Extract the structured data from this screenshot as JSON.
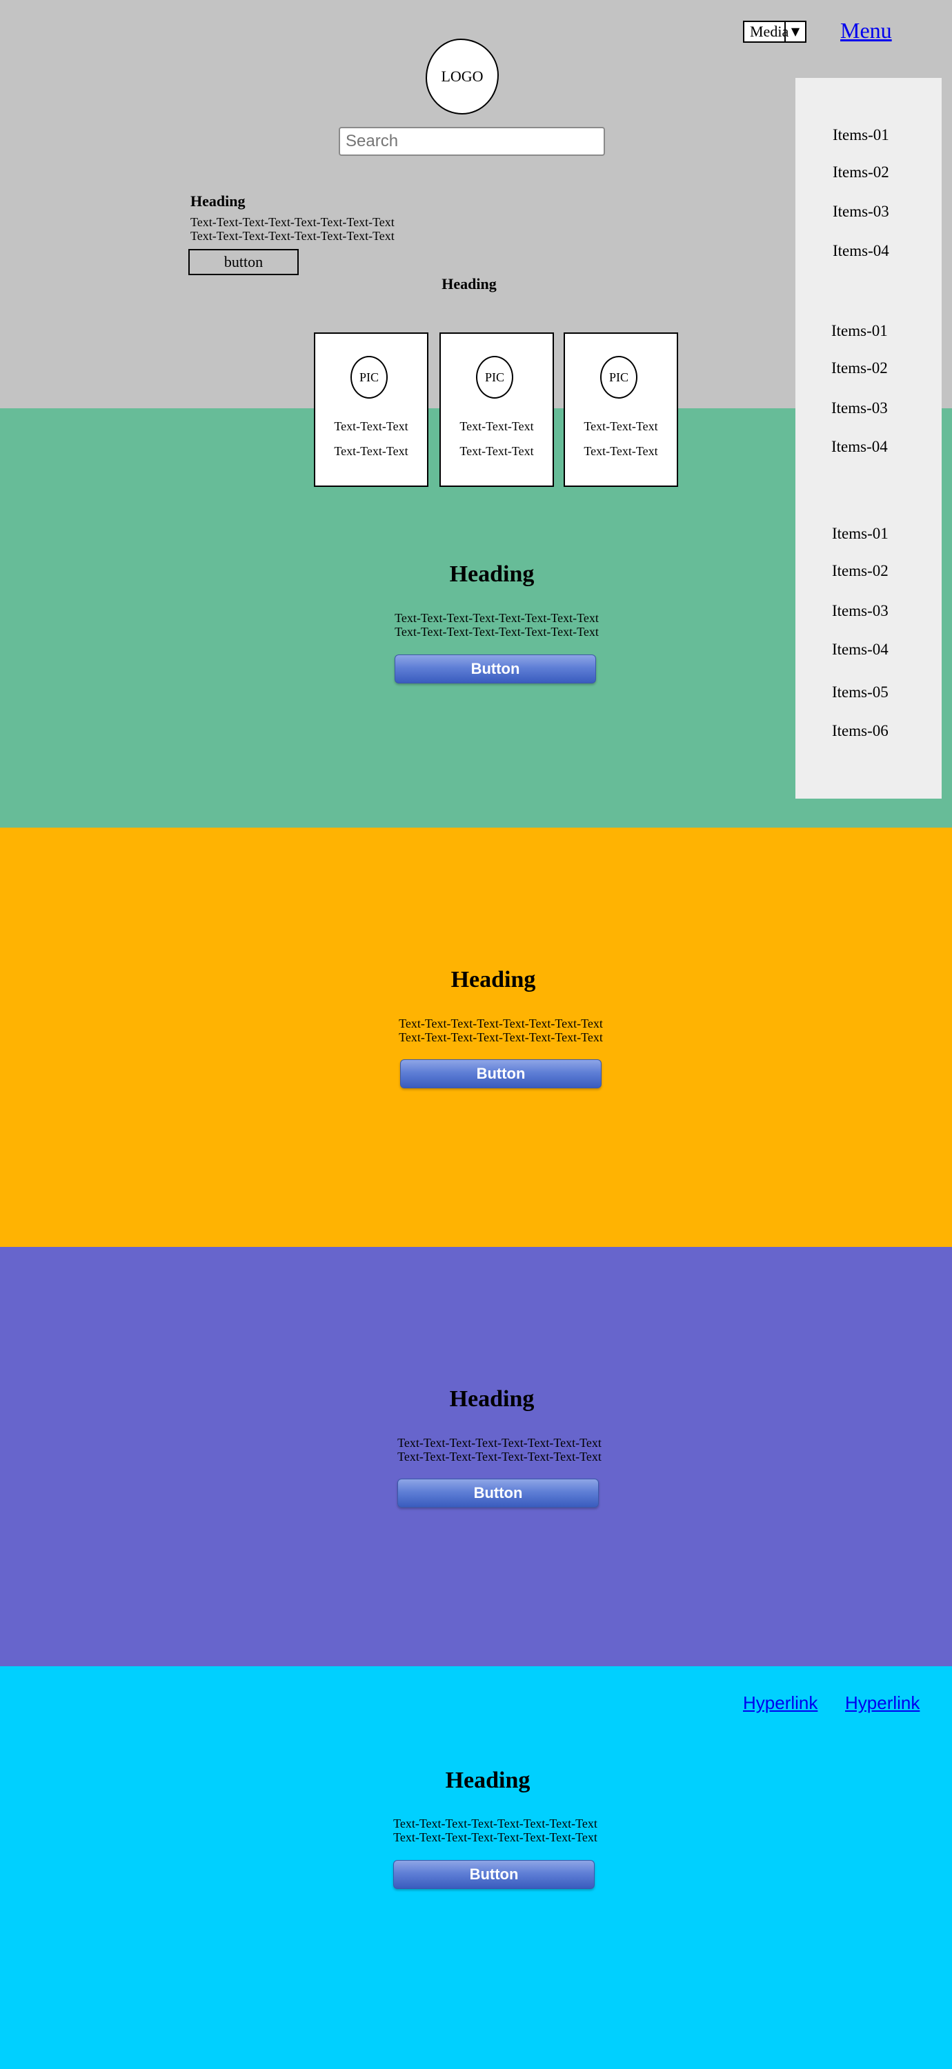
{
  "colors": {
    "header_bg": "#c3c3c3",
    "section1_bg": "#67bc98",
    "section2_bg": "#ffb302",
    "section3_bg": "#6765cc",
    "section4_bg": "#00d0ff",
    "sidebar_bg": "#eeeeee",
    "button_blue": "#5f7fd6"
  },
  "header": {
    "media_select": {
      "value": "Media",
      "icon": "chevron-down-icon"
    },
    "menu_label": "Menu",
    "logo_text": "LOGO",
    "search_placeholder": "Search",
    "intro": {
      "heading": "Heading",
      "lines": [
        "Text-Text-Text-Text-Text-Text-Text-Text",
        "Text-Text-Text-Text-Text-Text-Text-Text"
      ],
      "button_label": "button"
    },
    "center_heading": "Heading"
  },
  "cards": [
    {
      "pic": "PIC",
      "line1": "Text-Text-Text",
      "line2": "Text-Text-Text"
    },
    {
      "pic": "PIC",
      "line1": "Text-Text-Text",
      "line2": "Text-Text-Text"
    },
    {
      "pic": "PIC",
      "line1": "Text-Text-Text",
      "line2": "Text-Text-Text"
    }
  ],
  "sidebar": {
    "group1": [
      "Items-01",
      "Items-02",
      "Items-03",
      "Items-04"
    ],
    "group2": [
      "Items-01",
      "Items-02",
      "Items-03",
      "Items-04"
    ],
    "group3": [
      "Items-01",
      "Items-02",
      "Items-03",
      "Items-04",
      "Items-05",
      "Items-06"
    ]
  },
  "sections": [
    {
      "heading": "Heading",
      "lines": [
        "Text-Text-Text-Text-Text-Text-Text-Text",
        "Text-Text-Text-Text-Text-Text-Text-Text"
      ],
      "button_label": "Button"
    },
    {
      "heading": "Heading",
      "lines": [
        "Text-Text-Text-Text-Text-Text-Text-Text",
        "Text-Text-Text-Text-Text-Text-Text-Text"
      ],
      "button_label": "Button"
    },
    {
      "heading": "Heading",
      "lines": [
        "Text-Text-Text-Text-Text-Text-Text-Text",
        "Text-Text-Text-Text-Text-Text-Text-Text"
      ],
      "button_label": "Button"
    },
    {
      "heading": "Heading",
      "lines": [
        "Text-Text-Text-Text-Text-Text-Text-Text",
        "Text-Text-Text-Text-Text-Text-Text-Text"
      ],
      "button_label": "Button"
    }
  ],
  "footer_links": [
    "Hyperlink",
    "Hyperlink"
  ]
}
